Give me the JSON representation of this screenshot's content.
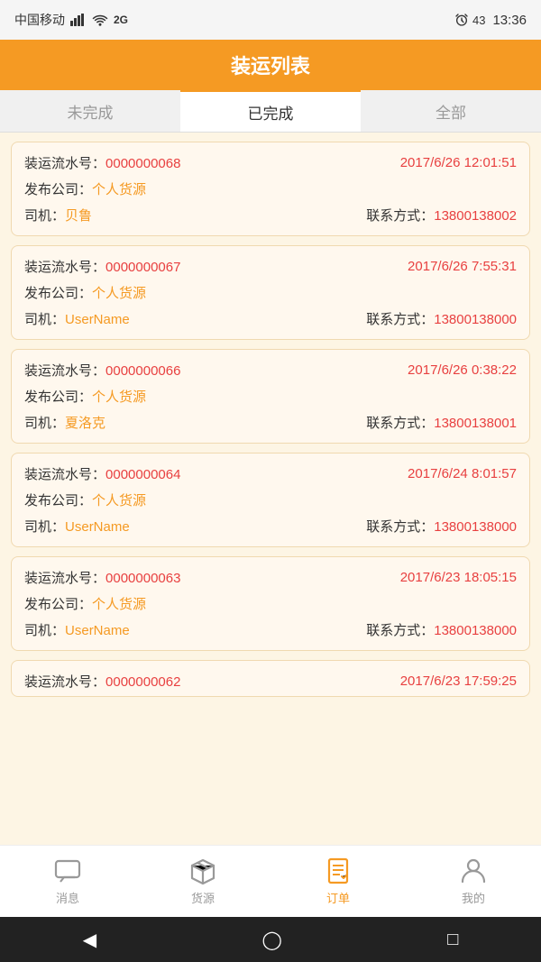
{
  "statusBar": {
    "carrier": "中国移动",
    "time": "13:36",
    "signal": "2G"
  },
  "header": {
    "title": "装运列表"
  },
  "tabs": [
    {
      "id": "incomplete",
      "label": "未完成",
      "active": false
    },
    {
      "id": "completed",
      "label": "已完成",
      "active": true
    },
    {
      "id": "all",
      "label": "全部",
      "active": false
    }
  ],
  "cards": [
    {
      "serialNo": "0000000068",
      "date": "2017/6/26 12:01:51",
      "company": "个人货源",
      "driver": "贝鲁",
      "contactLabel": "联系方式：",
      "contact": "13800138002"
    },
    {
      "serialNo": "0000000067",
      "date": "2017/6/26 7:55:31",
      "company": "个人货源",
      "driver": "UserName",
      "contactLabel": "联系方式：",
      "contact": "13800138000"
    },
    {
      "serialNo": "0000000066",
      "date": "2017/6/26 0:38:22",
      "company": "个人货源",
      "driver": "夏洛克",
      "contactLabel": "联系方式：",
      "contact": "13800138001"
    },
    {
      "serialNo": "0000000064",
      "date": "2017/6/24 8:01:57",
      "company": "个人货源",
      "driver": "UserName",
      "contactLabel": "联系方式：",
      "contact": "13800138000"
    },
    {
      "serialNo": "0000000063",
      "date": "2017/6/23 18:05:15",
      "company": "个人货源",
      "driver": "UserName",
      "contactLabel": "联系方式：",
      "contact": "13800138000"
    },
    {
      "serialNo": "0000000062",
      "date": "2017/6/23 17:59:25",
      "company": "",
      "driver": "",
      "contactLabel": "",
      "contact": ""
    }
  ],
  "labels": {
    "serialPrefix": "装运流水号：",
    "companyPrefix": "发布公司：",
    "driverPrefix": "司机："
  },
  "bottomNav": [
    {
      "id": "message",
      "label": "消息",
      "active": false,
      "icon": "chat"
    },
    {
      "id": "cargo",
      "label": "货源",
      "active": false,
      "icon": "box"
    },
    {
      "id": "order",
      "label": "订单",
      "active": true,
      "icon": "doc"
    },
    {
      "id": "mine",
      "label": "我的",
      "active": false,
      "icon": "person"
    }
  ]
}
